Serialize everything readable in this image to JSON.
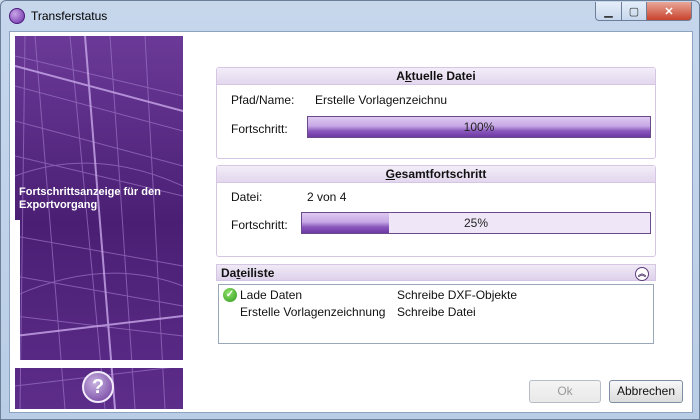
{
  "window": {
    "title": "Transferstatus",
    "min_glyph": "▁",
    "max_glyph": "▢",
    "close_glyph": "✕"
  },
  "side_panel": {
    "caption": "Fortschrittsanzeige für den Exportvorgang",
    "help_glyph": "?"
  },
  "current_file": {
    "heading_pre": "A",
    "heading_ul": "k",
    "heading_post": "tuelle Datei",
    "path_label": "Pfad/Name:",
    "path_value": "Erstelle Vorlagenzeichnu",
    "progress_label": "Fortschritt:",
    "progress_text": "100%",
    "progress_value": 1.0
  },
  "total": {
    "heading_pre": "",
    "heading_ul": "G",
    "heading_post": "esamtfortschritt",
    "file_label": "Datei:",
    "file_value": "2 von 4",
    "progress_label": "Fortschritt:",
    "progress_text": "25%",
    "progress_value": 0.25
  },
  "file_list": {
    "heading_pre": "Da",
    "heading_ul": "t",
    "heading_post": "eiliste",
    "collapse_glyph": "︽",
    "rows": [
      {
        "name": "Lade Daten",
        "status": "Schreibe DXF-Objekte",
        "done": true,
        "check_glyph": "✓"
      },
      {
        "name": "Erstelle Vorlagenzeichnung",
        "status": "Schreibe Datei",
        "done": false
      }
    ]
  },
  "buttons": {
    "ok": "Ok",
    "cancel": "Abbrechen"
  },
  "colors": {
    "accent": "#5a2a86",
    "progress_dark": "#6d3aa3",
    "progress_light": "#ddc9f0"
  }
}
